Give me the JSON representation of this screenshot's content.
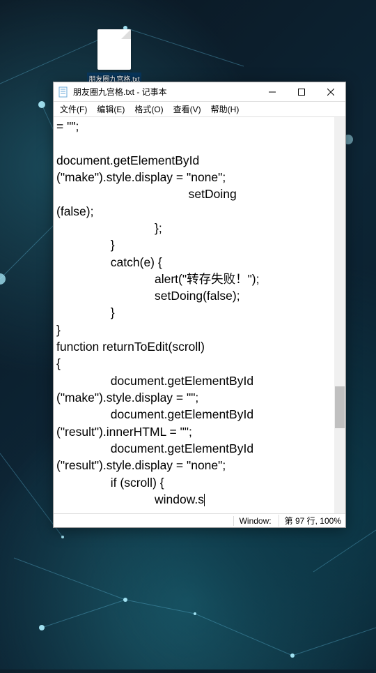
{
  "desktop": {
    "file_name": "朋友圈九宫格.txt"
  },
  "window": {
    "title": "朋友圈九宫格.txt - 记事本"
  },
  "menu": {
    "file": "文件(F)",
    "edit": "编辑(E)",
    "format": "格式(O)",
    "view": "查看(V)",
    "help": "帮助(H)"
  },
  "content": {
    "text": "= \"\";\n\ndocument.getElementById\n(\"make\").style.display = \"none\";\n                                       setDoing\n(false);\n                             };\n                }\n                catch(e) {\n                             alert(\"转存失败！\");\n                             setDoing(false);\n                }\n}\nfunction returnToEdit(scroll)\n{\n                document.getElementById\n(\"make\").style.display = \"\";\n                document.getElementById\n(\"result\").innerHTML = \"\";\n                document.getElementById\n(\"result\").style.display = \"none\";\n                if (scroll) {\n                             window.s"
  },
  "status": {
    "encoding": "Window:",
    "position": "第 97 行, 100%"
  }
}
